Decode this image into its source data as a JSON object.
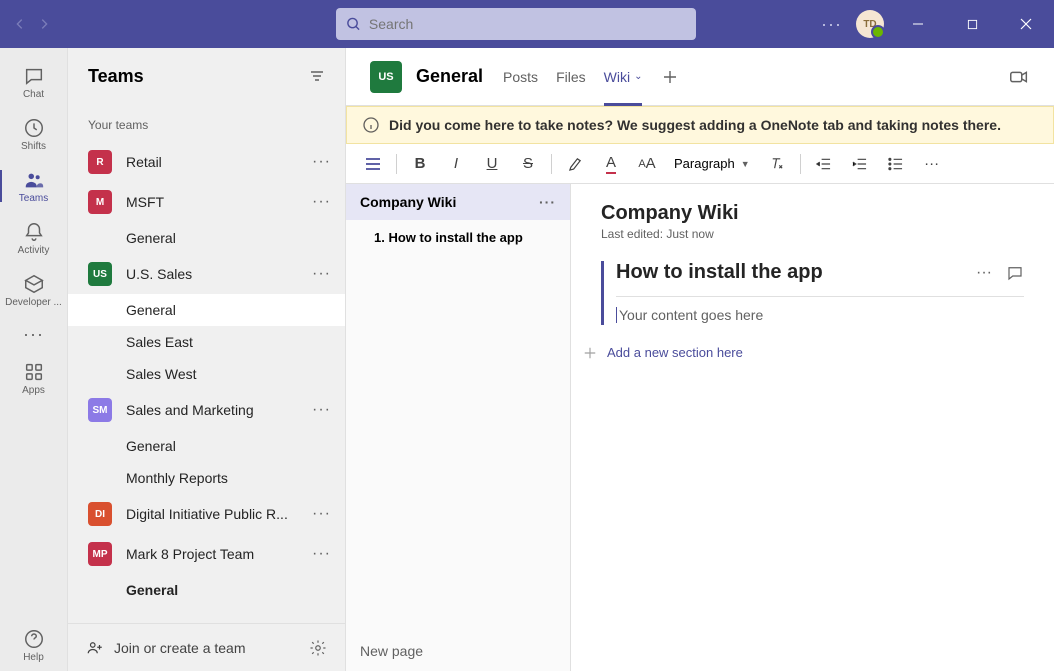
{
  "titlebar": {
    "search_placeholder": "Search",
    "avatar_initials": "TD"
  },
  "rail": {
    "items": [
      {
        "id": "chat",
        "label": "Chat"
      },
      {
        "id": "shifts",
        "label": "Shifts"
      },
      {
        "id": "teams",
        "label": "Teams"
      },
      {
        "id": "activity",
        "label": "Activity"
      },
      {
        "id": "developer",
        "label": "Developer ..."
      }
    ],
    "apps_label": "Apps",
    "help_label": "Help"
  },
  "teams_panel": {
    "title": "Teams",
    "your_teams_label": "Your teams",
    "teams": [
      {
        "initials": "R",
        "color": "#c4314b",
        "name": "Retail",
        "channels": []
      },
      {
        "initials": "M",
        "color": "#c4314b",
        "name": "MSFT",
        "channels": [
          {
            "name": "General"
          }
        ]
      },
      {
        "initials": "US",
        "color": "#1f7a3e",
        "name": "U.S. Sales",
        "channels": [
          {
            "name": "General",
            "selected": true
          },
          {
            "name": "Sales East"
          },
          {
            "name": "Sales West"
          }
        ]
      },
      {
        "initials": "SM",
        "color": "#8c7ae6",
        "name": "Sales and Marketing",
        "channels": [
          {
            "name": "General"
          },
          {
            "name": "Monthly Reports"
          }
        ]
      },
      {
        "initials": "DI",
        "color": "#d9502f",
        "name": "Digital Initiative Public R...",
        "channels": []
      },
      {
        "initials": "MP",
        "color": "#c4314b",
        "name": "Mark 8 Project Team",
        "channels": [
          {
            "name": "General",
            "bold": true
          }
        ]
      }
    ],
    "join_create_label": "Join or create a team"
  },
  "content_header": {
    "avatar_initials": "US",
    "title": "General",
    "tabs": [
      {
        "label": "Posts"
      },
      {
        "label": "Files"
      },
      {
        "label": "Wiki",
        "active": true,
        "dropdown": true
      }
    ]
  },
  "banner": {
    "text": "Did you come here to take notes? We suggest adding a OneNote tab and taking notes there."
  },
  "toolbar": {
    "paragraph_label": "Paragraph"
  },
  "wiki": {
    "page_title": "Company Wiki",
    "toc_item": "1. How to install the app",
    "new_page_label": "New page",
    "doc_title": "Company Wiki",
    "last_edited": "Last edited: Just now",
    "section_title": "How to install the app",
    "content_placeholder": "Your content goes here",
    "add_section_label": "Add a new section here"
  }
}
